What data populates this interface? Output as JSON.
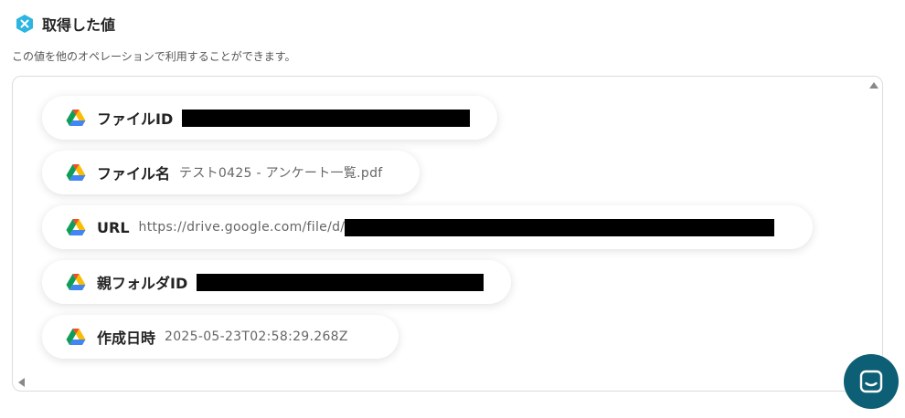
{
  "header": {
    "title": "取得した値",
    "icon": "x-hexagon-icon",
    "accent": "#2bb5e0"
  },
  "description": "この値を他のオペレーションで利用することができます。",
  "items": [
    {
      "label": "ファイルID",
      "value": "",
      "redacted": true
    },
    {
      "label": "ファイル名",
      "value": "テスト0425 - アンケート一覧.pdf"
    },
    {
      "label": "URL",
      "value": "https://drive.google.com/file/d/",
      "redacted": true
    },
    {
      "label": "親フォルダID",
      "value": "",
      "redacted": true
    },
    {
      "label": "作成日時",
      "value": "2025-05-23T02:58:29.268Z"
    }
  ],
  "chat": {
    "icon": "chat-icon",
    "color": "#0c5f74"
  }
}
